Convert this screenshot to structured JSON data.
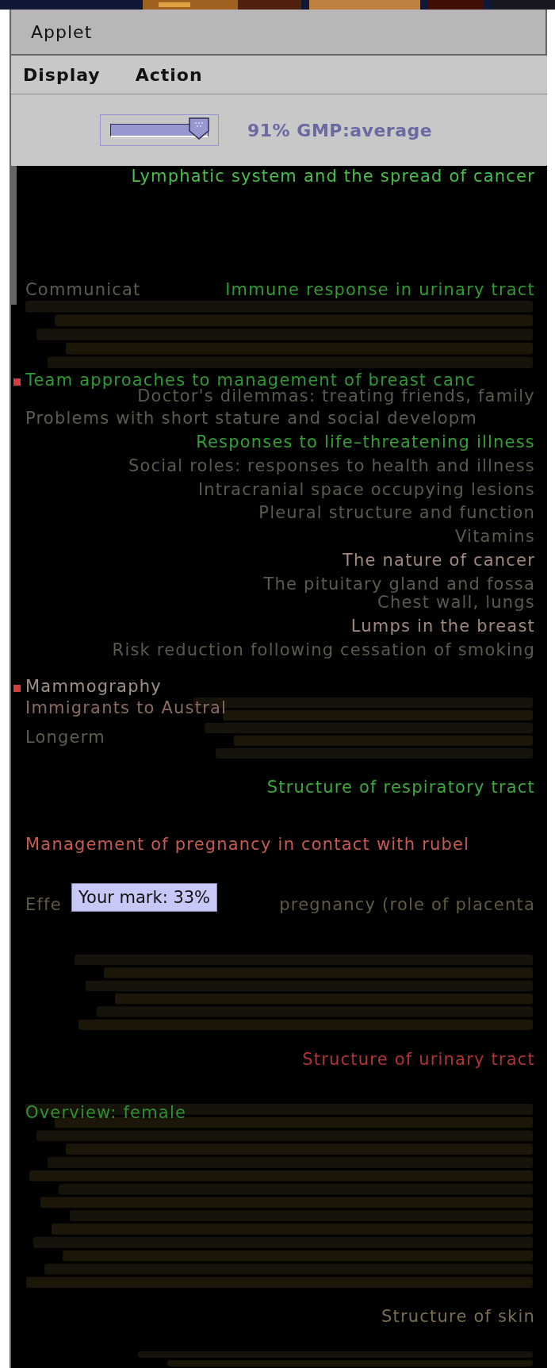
{
  "window": {
    "title": "Applet"
  },
  "menu": [
    "Display",
    "Action"
  ],
  "toolbar": {
    "slider": {
      "level": 0.91
    },
    "reading": "91% GMP:average"
  },
  "labels": [
    {
      "text": "Lymphatic system and the spread of cancer",
      "color": "#46c046",
      "flagged": false
    },
    {
      "text": "Communicat",
      "color": "#5c5c50",
      "flagged": false
    },
    {
      "text": "Immune response in urinary tract",
      "color": "#2f9a2f",
      "flagged": false
    },
    {
      "text": "Team approaches to management of breast canc",
      "color": "#2f9a2f",
      "flagged": true
    },
    {
      "text": "Doctor's dilemmas: treating friends, family",
      "color": "#5a5a4e",
      "flagged": false
    },
    {
      "text": "Problems with short stature and social developm",
      "color": "#5c5c50",
      "flagged": false
    },
    {
      "text": "Responses to life–threatening illness",
      "color": "#32a032",
      "flagged": false
    },
    {
      "text": "Social roles: responses to health and illness",
      "color": "#5a5a4e",
      "flagged": false
    },
    {
      "text": "Intracranial space occupying lesions",
      "color": "#5a5a4e",
      "flagged": false
    },
    {
      "text": "Pleural structure and function",
      "color": "#5a5a4e",
      "flagged": false
    },
    {
      "text": "Vitamins",
      "color": "#5a5a4e",
      "flagged": false
    },
    {
      "text": "The nature of cancer",
      "color": "#a08880",
      "flagged": false
    },
    {
      "text": "The pituitary gland and fossa",
      "color": "#5a5a4e",
      "flagged": false
    },
    {
      "text": "Chest wall, lungs",
      "color": "#5a5a4e",
      "flagged": false
    },
    {
      "text": "Lumps in the breast",
      "color": "#a08880",
      "flagged": false
    },
    {
      "text": "Risk reduction following cessation of smoking",
      "color": "#5a5a4e",
      "flagged": false
    },
    {
      "text": "Mammography",
      "color": "#a0908a",
      "flagged": true
    },
    {
      "text": "Immigrants to Austral",
      "color": "#8a6a62",
      "flagged": false
    },
    {
      "text": "Longerm",
      "color": "#5c5c50",
      "flagged": false
    },
    {
      "text": "Structure of respiratory tract",
      "color": "#3aaa3a",
      "flagged": false
    },
    {
      "text": "Management of pregnancy in contact with rubel",
      "color": "#c85a50",
      "flagged": false
    },
    {
      "text": "Effe",
      "color": "#5e5a44",
      "flagged": false
    },
    {
      "text": "pregnancy (role of placenta",
      "color": "#5e5a44",
      "flagged": false
    },
    {
      "text": "Structure of urinary tract",
      "color": "#b03434",
      "flagged": false
    },
    {
      "text": "Overview: female",
      "color": "#2e902e",
      "flagged": false
    },
    {
      "text": "Structure of skin",
      "color": "#7a6e52",
      "flagged": false
    }
  ],
  "tooltip": {
    "text": "Your mark: 33%"
  }
}
